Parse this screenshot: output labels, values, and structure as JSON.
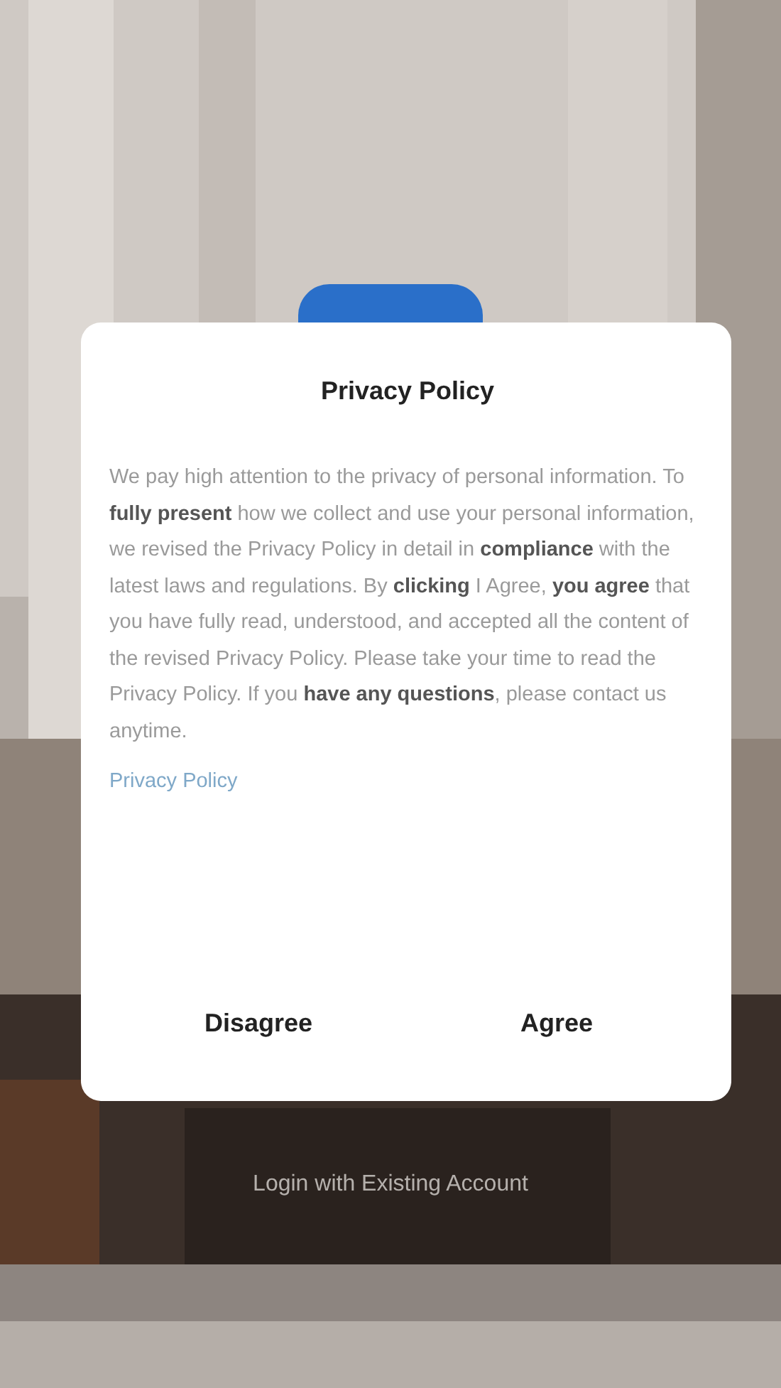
{
  "dialog": {
    "title": "Privacy Policy",
    "body": "We pay high attention to the privacy of personal information. To **fully present** how we collect and use your personal information, we revised the Privacy Policy in detail in **compliance** with the latest laws and regulations. By **clicking** I Agree, **you agree** that you have fully read, understood, and accepted all the content of the revised Privacy Policy. Please take your time to read the Privacy Policy. If you **have any questions**, please contact us anytime.",
    "link": "Privacy Policy",
    "buttons": [
      "Disagree",
      "Agree"
    ]
  },
  "background": {
    "kind": "picture",
    "link": "Login with Existing Account"
  }
}
